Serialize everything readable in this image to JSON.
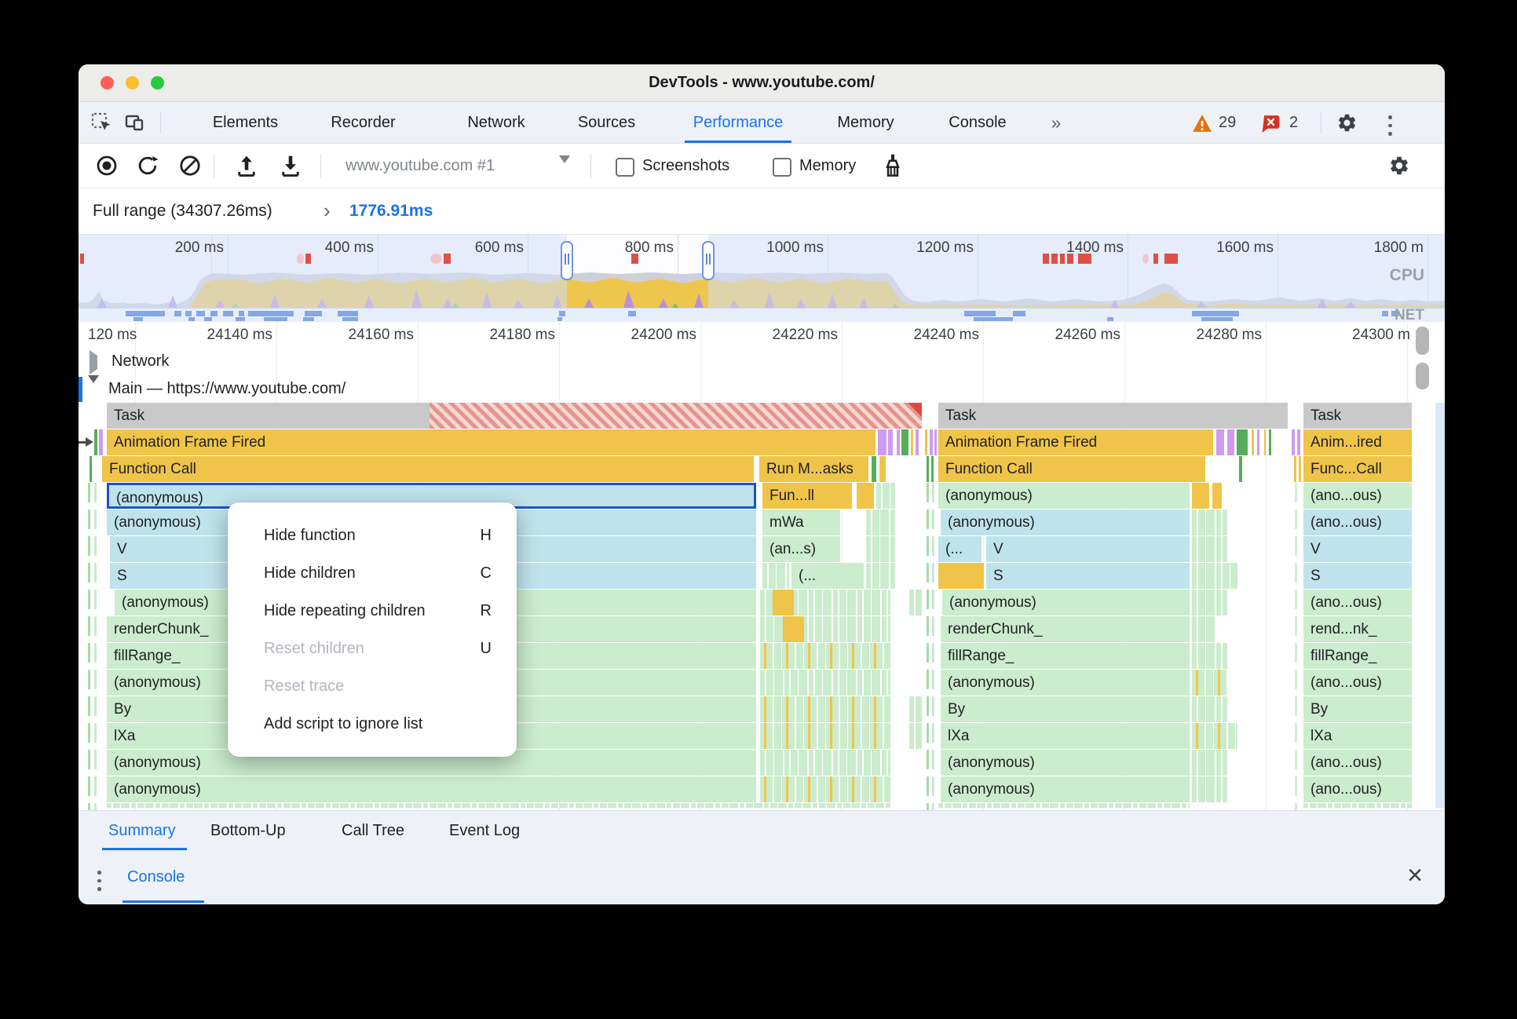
{
  "window": {
    "title": "DevTools - www.youtube.com/"
  },
  "tabs": {
    "items": [
      "Elements",
      "Recorder",
      "Network",
      "Sources",
      "Performance",
      "Memory",
      "Console"
    ],
    "active": "Performance",
    "overflow_chevron": "»",
    "warning_count": "29",
    "error_count": "2"
  },
  "toolbar": {
    "target_select": "www.youtube.com #1",
    "screenshots_label": "Screenshots",
    "memory_label": "Memory"
  },
  "breadcrumb": {
    "full_range": "Full range (34307.26ms)",
    "chevron": "›",
    "selected_range": "1776.91ms"
  },
  "overview": {
    "ticks": [
      "200 ms",
      "400 ms",
      "600 ms",
      "800 ms",
      "1000 ms",
      "1200 ms",
      "1400 ms",
      "1600 ms",
      "1800 m"
    ],
    "cpu_label": "CPU",
    "net_label": "NET"
  },
  "ruler": {
    "ticks": [
      "120 ms",
      "24140 ms",
      "24160 ms",
      "24180 ms",
      "24200 ms",
      "24220 ms",
      "24240 ms",
      "24260 ms",
      "24280 ms",
      "24300 m"
    ]
  },
  "flame": {
    "network_label": "Network",
    "main_label": "Main — https://www.youtube.com/",
    "s1": {
      "task": "Task",
      "aff": "Animation Frame Fired",
      "fc": "Function Call",
      "run_m": "Run M...asks",
      "fun": "Fun...ll",
      "mid": [
        "mWa",
        "(an...s)",
        "(..."
      ],
      "rows": [
        "(anonymous)",
        "(anonymous)",
        "V",
        "S",
        "(anonymous)",
        "renderChunk_",
        "fillRange_",
        "(anonymous)",
        "By",
        "lXa",
        "(anonymous)",
        "(anonymous)"
      ]
    },
    "s2": {
      "task": "Task",
      "aff": "Animation Frame Fired",
      "fc": "Function Call",
      "rows": [
        "(anonymous)",
        "(anonymous)",
        "(...",
        "V",
        "S",
        "(anonymous)",
        "renderChunk_",
        "fillRange_",
        "(anonymous)",
        "By",
        "lXa",
        "(anonymous)",
        "(anonymous)"
      ]
    },
    "s3": {
      "task": "Task",
      "rows": [
        "Anim...ired",
        "Func...Call",
        "(ano...ous)",
        "(ano...ous)",
        "V",
        "S",
        "(ano...ous)",
        "rend...nk_",
        "fillRange_",
        "(ano...ous)",
        "By",
        "lXa",
        "(ano...ous)",
        "(ano...ous)"
      ]
    }
  },
  "context_menu": {
    "items": [
      {
        "label": "Hide function",
        "shortcut": "H"
      },
      {
        "label": "Hide children",
        "shortcut": "C"
      },
      {
        "label": "Hide repeating children",
        "shortcut": "R"
      },
      {
        "label": "Reset children",
        "shortcut": "U"
      },
      {
        "label": "Reset trace",
        "shortcut": ""
      },
      {
        "label": "Add script to ignore list",
        "shortcut": ""
      }
    ]
  },
  "bottom_tabs": {
    "items": [
      "Summary",
      "Bottom-Up",
      "Call Tree",
      "Event Log"
    ],
    "active": "Summary"
  },
  "console_drawer": {
    "tab": "Console"
  },
  "colors": {
    "accent_blue": "#1a73e8",
    "scripting_yellow": "#f0c449",
    "green": "#cbeccd",
    "teal": "#bfe3ec",
    "purple": "#cf9bf0",
    "task_gray": "#c9c9c9",
    "warning_orange": "#e8710a",
    "error_red": "#d93025",
    "selection_border": "#1a53c7"
  }
}
